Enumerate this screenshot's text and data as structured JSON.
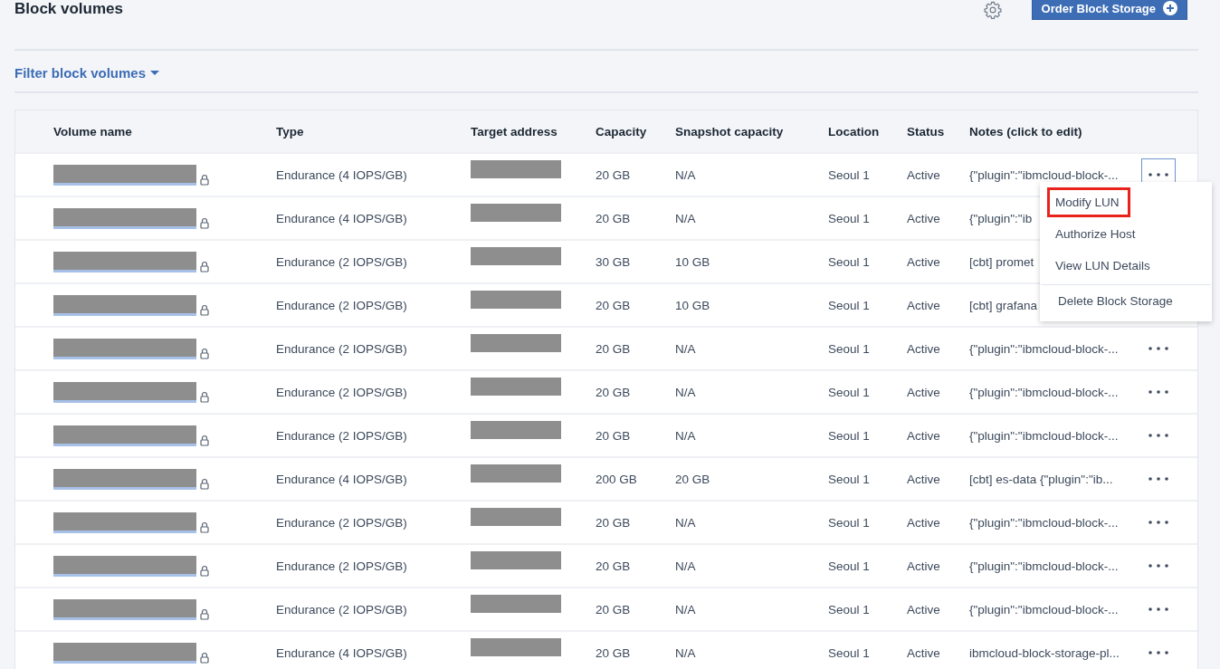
{
  "header": {
    "title": "Block volumes",
    "order_button": "Order Block Storage"
  },
  "filter": {
    "label": "Filter block volumes"
  },
  "table": {
    "columns": [
      "Volume name",
      "Type",
      "Target address",
      "Capacity",
      "Snapshot capacity",
      "Location",
      "Status",
      "Notes (click to edit)"
    ],
    "rows": [
      {
        "type": "Endurance (4 IOPS/GB)",
        "capacity": "20 GB",
        "snapshot_capacity": "N/A",
        "location": "Seoul 1",
        "status": "Active",
        "notes": "{\"plugin\":\"ibmcloud-block-...",
        "menu_open": true
      },
      {
        "type": "Endurance (4 IOPS/GB)",
        "capacity": "20 GB",
        "snapshot_capacity": "N/A",
        "location": "Seoul 1",
        "status": "Active",
        "notes": "{\"plugin\":\"ib",
        "menu_open": false
      },
      {
        "type": "Endurance (2 IOPS/GB)",
        "capacity": "30 GB",
        "snapshot_capacity": "10 GB",
        "location": "Seoul 1",
        "status": "Active",
        "notes": "[cbt] promet",
        "menu_open": false
      },
      {
        "type": "Endurance (2 IOPS/GB)",
        "capacity": "20 GB",
        "snapshot_capacity": "10 GB",
        "location": "Seoul 1",
        "status": "Active",
        "notes": "[cbt] grafana",
        "menu_open": false
      },
      {
        "type": "Endurance (2 IOPS/GB)",
        "capacity": "20 GB",
        "snapshot_capacity": "N/A",
        "location": "Seoul 1",
        "status": "Active",
        "notes": "{\"plugin\":\"ibmcloud-block-...",
        "menu_open": false
      },
      {
        "type": "Endurance (2 IOPS/GB)",
        "capacity": "20 GB",
        "snapshot_capacity": "N/A",
        "location": "Seoul 1",
        "status": "Active",
        "notes": "{\"plugin\":\"ibmcloud-block-...",
        "menu_open": false
      },
      {
        "type": "Endurance (2 IOPS/GB)",
        "capacity": "20 GB",
        "snapshot_capacity": "N/A",
        "location": "Seoul 1",
        "status": "Active",
        "notes": "{\"plugin\":\"ibmcloud-block-...",
        "menu_open": false
      },
      {
        "type": "Endurance (4 IOPS/GB)",
        "capacity": "200 GB",
        "snapshot_capacity": "20 GB",
        "location": "Seoul 1",
        "status": "Active",
        "notes": "[cbt] es-data {\"plugin\":\"ib...",
        "menu_open": false
      },
      {
        "type": "Endurance (2 IOPS/GB)",
        "capacity": "20 GB",
        "snapshot_capacity": "N/A",
        "location": "Seoul 1",
        "status": "Active",
        "notes": "{\"plugin\":\"ibmcloud-block-...",
        "menu_open": false
      },
      {
        "type": "Endurance (2 IOPS/GB)",
        "capacity": "20 GB",
        "snapshot_capacity": "N/A",
        "location": "Seoul 1",
        "status": "Active",
        "notes": "{\"plugin\":\"ibmcloud-block-...",
        "menu_open": false
      },
      {
        "type": "Endurance (2 IOPS/GB)",
        "capacity": "20 GB",
        "snapshot_capacity": "N/A",
        "location": "Seoul 1",
        "status": "Active",
        "notes": "{\"plugin\":\"ibmcloud-block-...",
        "menu_open": false
      },
      {
        "type": "Endurance (4 IOPS/GB)",
        "capacity": "20 GB",
        "snapshot_capacity": "N/A",
        "location": "Seoul 1",
        "status": "Active",
        "notes": "ibmcloud-block-storage-pl...",
        "menu_open": false
      }
    ]
  },
  "menu": {
    "items": [
      {
        "label": "Modify LUN",
        "highlighted": true,
        "divider_before": false
      },
      {
        "label": "Authorize Host",
        "highlighted": false,
        "divider_before": false
      },
      {
        "label": "View LUN Details",
        "highlighted": false,
        "divider_before": false
      },
      {
        "label": "Delete Block Storage",
        "highlighted": false,
        "divider_before": true
      }
    ]
  }
}
